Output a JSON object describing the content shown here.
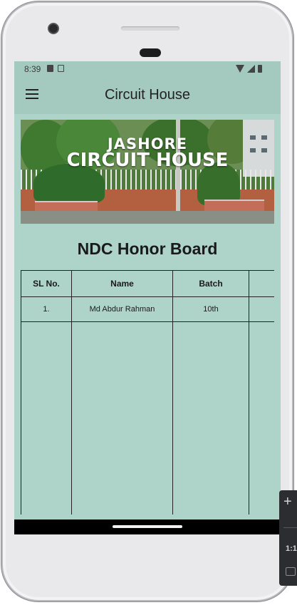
{
  "status_bar": {
    "time": "8:39"
  },
  "app_bar": {
    "title": "Circuit House"
  },
  "banner": {
    "line1": "JASHORE",
    "line2": "CIRCUIT HOUSE"
  },
  "heading": "NDC Honor Board",
  "table": {
    "headers": [
      "SL No.",
      "Name",
      "Batch",
      ""
    ],
    "rows": [
      [
        "1.",
        "Md Abdur Rahman",
        "10th",
        ""
      ]
    ]
  },
  "emulator_toolbar": {
    "plus": "+",
    "ratio": "1:1"
  },
  "colors": {
    "screen_bg": "#aed3c8",
    "app_bar_bg": "#a4c9bf",
    "nav_bar": "#000000"
  }
}
